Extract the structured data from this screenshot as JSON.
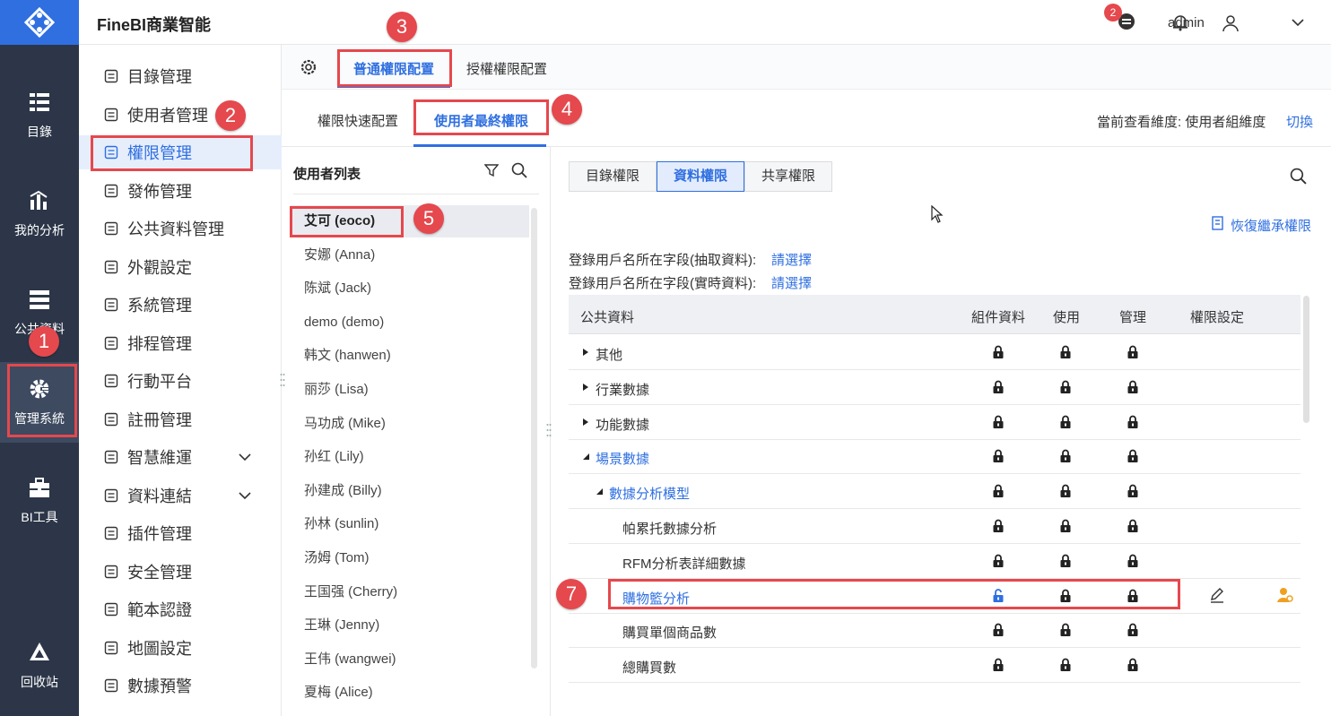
{
  "app": {
    "title": "FineBI商業智能"
  },
  "rail": {
    "items": [
      {
        "label": "目錄",
        "icon": "catalog-icon"
      },
      {
        "label": "我的分析",
        "icon": "analysis-icon"
      },
      {
        "label": "公共資料",
        "icon": "public-data-icon"
      },
      {
        "label": "管理系統",
        "icon": "gear-icon"
      },
      {
        "label": "BI工具",
        "icon": "toolbox-icon"
      },
      {
        "label": "回收站",
        "icon": "recycle-icon"
      }
    ]
  },
  "header": {
    "notification_count": "2",
    "user": "admin"
  },
  "menu": {
    "items": [
      {
        "label": "目錄管理"
      },
      {
        "label": "使用者管理"
      },
      {
        "label": "權限管理"
      },
      {
        "label": "發佈管理"
      },
      {
        "label": "公共資料管理"
      },
      {
        "label": "外觀設定"
      },
      {
        "label": "系統管理"
      },
      {
        "label": "排程管理"
      },
      {
        "label": "行動平台"
      },
      {
        "label": "註冊管理"
      },
      {
        "label": "智慧維運"
      },
      {
        "label": "資料連結"
      },
      {
        "label": "插件管理"
      },
      {
        "label": "安全管理"
      },
      {
        "label": "範本認證"
      },
      {
        "label": "地圖設定"
      },
      {
        "label": "數據預警"
      }
    ]
  },
  "tabs": {
    "general": "普通權限配置",
    "grant": "授權權限配置"
  },
  "subtabs": {
    "quick": "權限快速配置",
    "final": "使用者最終權限"
  },
  "dimension": {
    "label": "當前查看維度: 使用者組維度",
    "switch": "切換"
  },
  "user_list": {
    "title": "使用者列表",
    "users": [
      "艾可 (eoco)",
      "安娜 (Anna)",
      "陈斌 (Jack)",
      "demo (demo)",
      "韩文 (hanwen)",
      "丽莎 (Lisa)",
      "马功成 (Mike)",
      "孙红 (Lily)",
      "孙建成 (Billy)",
      "孙林 (sunlin)",
      "汤姆 (Tom)",
      "王国强 (Cherry)",
      "王琳 (Jenny)",
      "王伟 (wangwei)",
      "夏梅 (Alice)"
    ]
  },
  "perm_tabs": {
    "catalog": "目錄權限",
    "data": "資料權限",
    "share": "共享權限"
  },
  "restore": "恢復繼承權限",
  "fields": {
    "extract_label": "登錄用戶名所在字段(抽取資料):",
    "extract_link": "請選擇",
    "realtime_label": "登錄用戶名所在字段(實時資料):",
    "realtime_link": "請選擇"
  },
  "table": {
    "headers": {
      "name": "公共資料",
      "component": "組件資料",
      "use": "使用",
      "manage": "管理",
      "settings": "權限設定"
    },
    "rows": [
      {
        "name": "其他"
      },
      {
        "name": "行業數據"
      },
      {
        "name": "功能數據"
      },
      {
        "name": "場景數據"
      },
      {
        "name": "數據分析模型"
      },
      {
        "name": "帕累托數據分析"
      },
      {
        "name": "RFM分析表詳細數據"
      },
      {
        "name": "購物籃分析"
      },
      {
        "name": "購買單個商品數"
      },
      {
        "name": "總購買數"
      }
    ]
  },
  "annotations": [
    "1",
    "2",
    "3",
    "4",
    "5",
    "7"
  ],
  "colors": {
    "accent": "#2f6fe0",
    "rail": "#2c3648",
    "annotation": "#e5484d"
  }
}
